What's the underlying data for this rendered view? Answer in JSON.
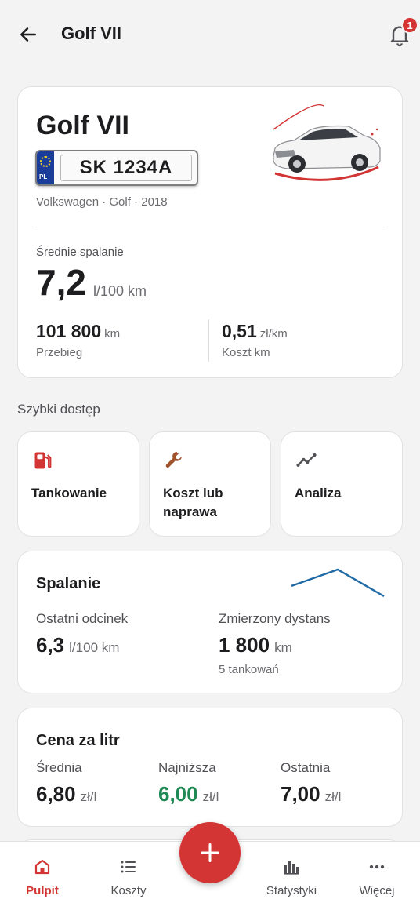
{
  "header": {
    "title": "Golf VII",
    "notification_count": "1"
  },
  "vehicle": {
    "name": "Golf VII",
    "plate_country": "PL",
    "plate": "SK 1234A",
    "details": "Volkswagen · Golf · 2018",
    "avg_label": "Średnie spalanie",
    "avg_value": "7,2",
    "avg_unit": "l/100 km",
    "mileage_value": "101 800",
    "mileage_unit": "km",
    "mileage_label": "Przebieg",
    "cost_value": "0,51",
    "cost_unit": "zł/km",
    "cost_label": "Koszt km"
  },
  "quick_access": {
    "title": "Szybki dostęp",
    "items": [
      {
        "label": "Tankowanie",
        "icon": "fuel-pump-icon"
      },
      {
        "label": "Koszt lub naprawa",
        "icon": "wrench-icon"
      },
      {
        "label": "Analiza",
        "icon": "trend-line-icon"
      }
    ]
  },
  "consumption": {
    "title": "Spalanie",
    "last_label": "Ostatni odcinek",
    "last_value": "6,3",
    "last_unit": "l/100 km",
    "distance_label": "Zmierzony dystans",
    "distance_value": "1 800",
    "distance_unit": "km",
    "refuels_note": "5 tankowań",
    "sparkline": [
      6.8,
      7.6,
      6.3
    ]
  },
  "price": {
    "title": "Cena za litr",
    "avg_label": "Średnia",
    "avg_value": "6,80",
    "min_label": "Najniższa",
    "min_value": "6,00",
    "last_label": "Ostatnia",
    "last_value": "7,00",
    "unit": "zł/l"
  },
  "nav": {
    "items": [
      {
        "label": "Pulpit",
        "icon": "home-icon",
        "active": true
      },
      {
        "label": "Koszty",
        "icon": "list-icon",
        "active": false
      },
      {
        "label": "Statystyki",
        "icon": "bar-chart-icon",
        "active": false
      },
      {
        "label": "Więcej",
        "icon": "more-dots-icon",
        "active": false
      }
    ]
  },
  "colors": {
    "accent": "#d33534",
    "positive": "#1f8a55",
    "sparkline": "#1f6aa5",
    "wrench": "#a0522d"
  }
}
